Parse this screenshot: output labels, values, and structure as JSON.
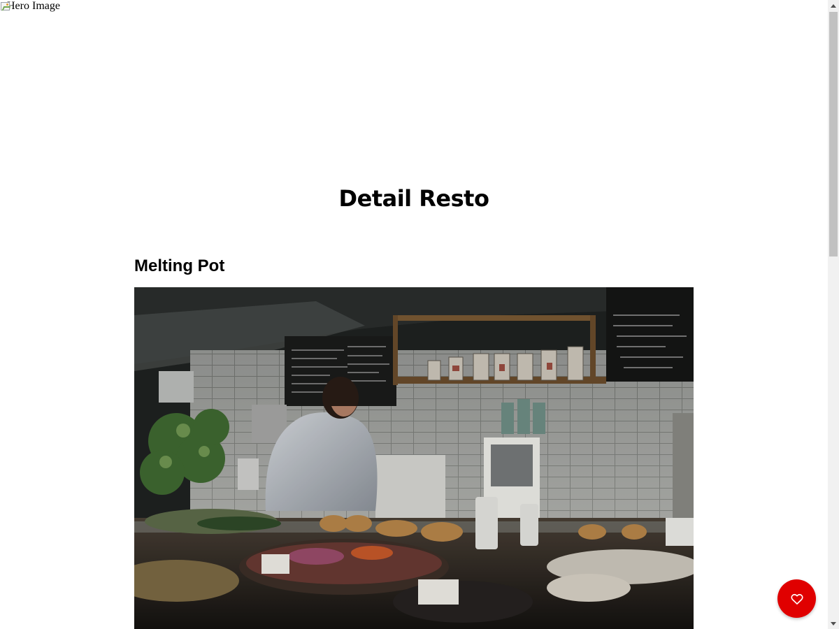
{
  "hero": {
    "alt_text": "Hero Image",
    "icon": "broken-image-icon"
  },
  "page": {
    "title": "Detail Resto"
  },
  "restaurant": {
    "name": "Melting Pot",
    "image_alt": "Melting Pot"
  },
  "favorite_button": {
    "icon": "heart-icon",
    "aria_label": "like this restaurant",
    "color": "#e00000"
  }
}
